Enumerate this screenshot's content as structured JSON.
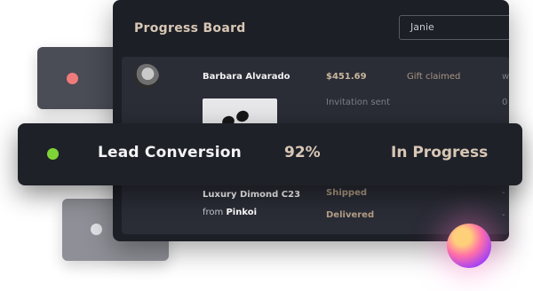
{
  "colors": {
    "panel_bg": "#1d1f27",
    "list_bg": "#2a2c36",
    "accent_tan": "#d8c7b5",
    "status_red": "#f07b7b",
    "status_green": "#7ed436",
    "status_grey": "#e1e2e6"
  },
  "board": {
    "title": "Progress Board",
    "search_value": "Janie",
    "row1": {
      "name": "Barbara Alvarado",
      "price": "$451.69",
      "status": "Gift claimed",
      "edge_fragment_1": "w",
      "edge_fragment_2": "0"
    },
    "row2": {
      "status": "Invitation sent"
    },
    "product": {
      "name": "Luxury Dimond C23",
      "from_label": "from",
      "from_value": "Pinkoi",
      "status_1": "Shipped",
      "status_2": "Delivered",
      "edge_fragment_1": "-",
      "edge_fragment_2": "-"
    }
  },
  "lead_bar": {
    "label": "Lead Conversion",
    "percent": "92%",
    "status": "In Progress"
  },
  "icons": {
    "red_dot": "status-dot-red-icon",
    "green_dot": "status-dot-green-icon",
    "grey_dot": "status-dot-grey-icon",
    "orb": "gradient-orb-icon"
  }
}
